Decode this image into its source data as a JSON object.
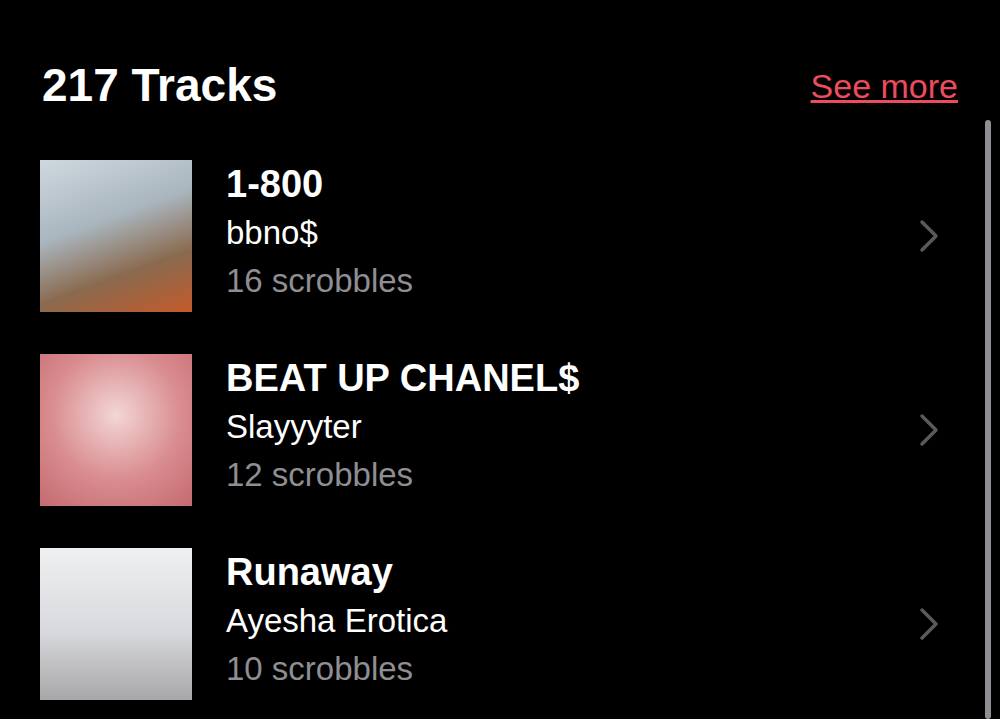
{
  "header": {
    "title": "217 Tracks",
    "link": "See more"
  },
  "tracks": [
    {
      "title": "1-800",
      "artist": "bbno$",
      "scrobbles": "16 scrobbles"
    },
    {
      "title": "BEAT UP CHANEL$",
      "artist": "Slayyyter",
      "scrobbles": "12 scrobbles"
    },
    {
      "title": "Runaway",
      "artist": "Ayesha Erotica",
      "scrobbles": "10 scrobbles"
    }
  ],
  "scrollbar": {
    "level": 1
  }
}
